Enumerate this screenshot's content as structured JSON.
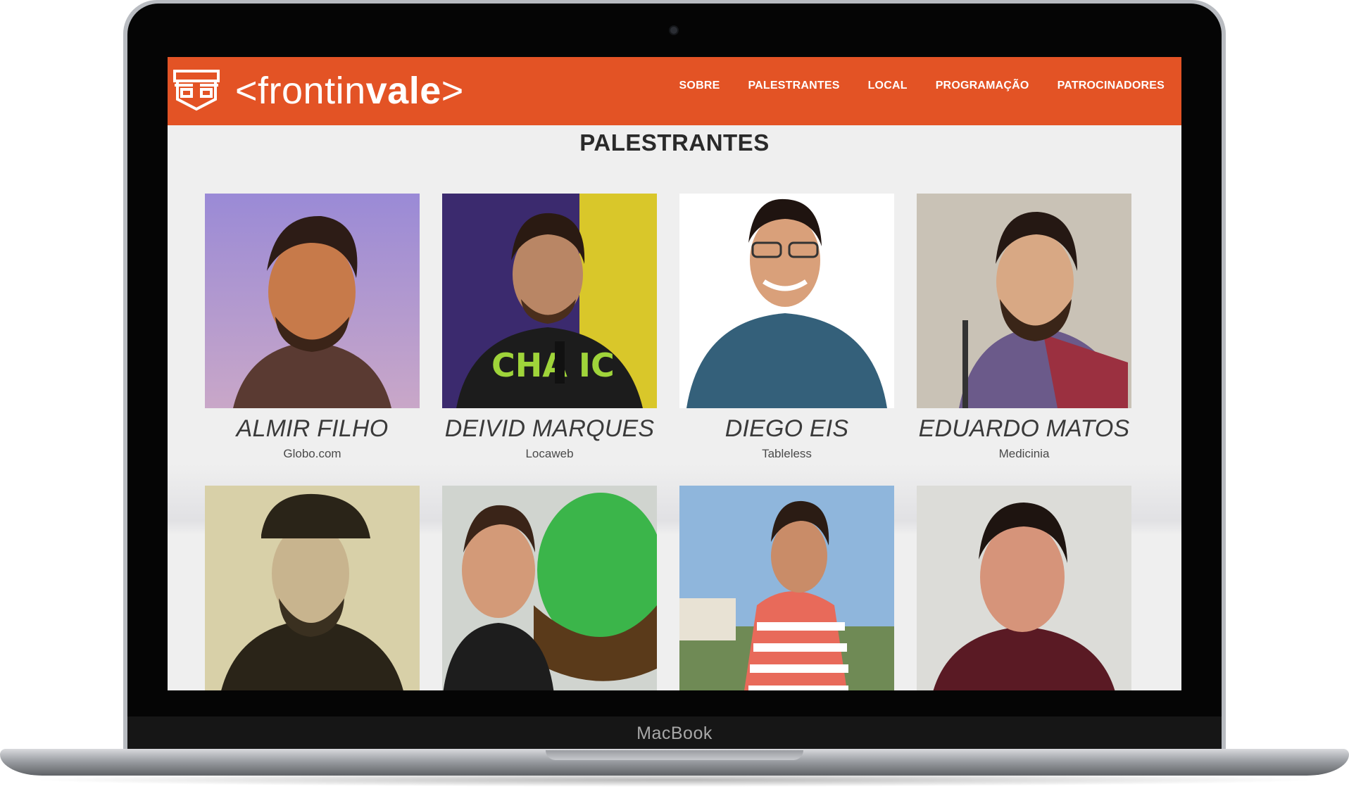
{
  "device": {
    "brand": "MacBook"
  },
  "site": {
    "logo_prefix": "<frontin",
    "logo_bold": "vale",
    "logo_suffix": ">",
    "brand_color": "#e35325"
  },
  "nav": {
    "items": [
      {
        "label": "SOBRE"
      },
      {
        "label": "PALESTRANTES"
      },
      {
        "label": "LOCAL"
      },
      {
        "label": "PROGRAMAÇÃO"
      },
      {
        "label": "PATROCINADORES"
      }
    ]
  },
  "section": {
    "title": "PALESTRANTES"
  },
  "speakers": [
    {
      "name": "ALMIR FILHO",
      "company": "Globo.com",
      "photo": "speaker-photo"
    },
    {
      "name": "DEIVID MARQUES",
      "company": "Locaweb",
      "photo": "speaker-photo"
    },
    {
      "name": "DIEGO EIS",
      "company": "Tableless",
      "photo": "speaker-photo"
    },
    {
      "name": "EDUARDO MATOS",
      "company": "Medicinia",
      "photo": "speaker-photo"
    },
    {
      "photo": "speaker-photo"
    },
    {
      "photo": "speaker-photo"
    },
    {
      "photo": "speaker-photo"
    },
    {
      "photo": "speaker-photo"
    }
  ]
}
